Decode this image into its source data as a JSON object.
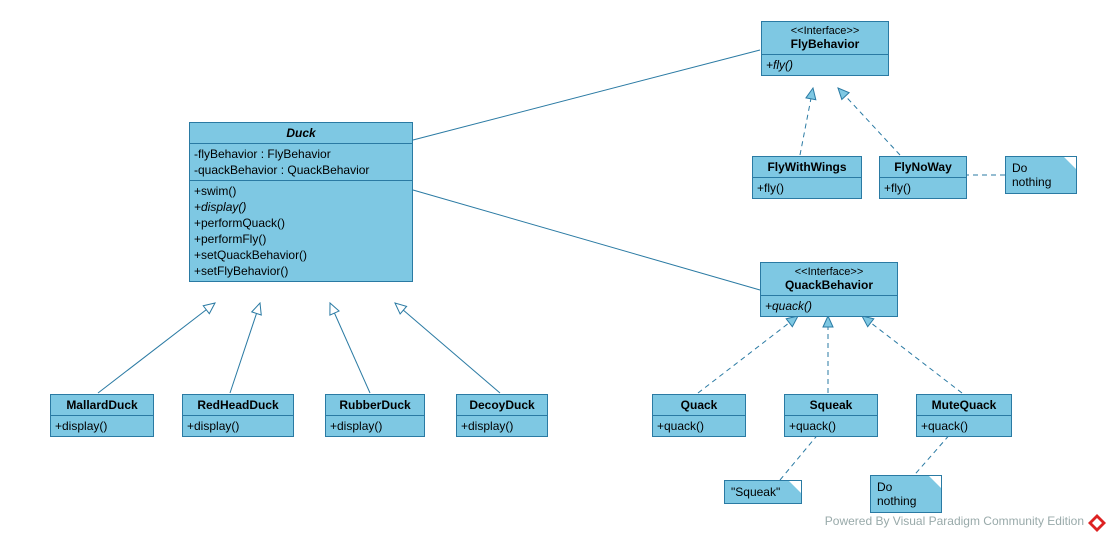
{
  "duck": {
    "name": "Duck",
    "attrs": [
      "-flyBehavior : FlyBehavior",
      "-quackBehavior : QuackBehavior"
    ],
    "ops": [
      "+swim()",
      "+display()",
      "+performQuack()",
      "+performFly()",
      "+setQuackBehavior()",
      "+setFlyBehavior()"
    ],
    "ops_italic": [
      false,
      true,
      false,
      false,
      false,
      false
    ]
  },
  "mallard": {
    "name": "MallardDuck",
    "ops": [
      "+display()"
    ]
  },
  "redhead": {
    "name": "RedHeadDuck",
    "ops": [
      "+display()"
    ]
  },
  "rubber": {
    "name": "RubberDuck",
    "ops": [
      "+display()"
    ]
  },
  "decoy": {
    "name": "DecoyDuck",
    "ops": [
      "+display()"
    ]
  },
  "flyBehavior": {
    "stereo": "<<Interface>>",
    "name": "FlyBehavior",
    "ops": [
      "+fly()"
    ],
    "ops_italic": [
      true
    ]
  },
  "flyWithWings": {
    "name": "FlyWithWings",
    "ops": [
      "+fly()"
    ]
  },
  "flyNoWay": {
    "name": "FlyNoWay",
    "ops": [
      "+fly()"
    ]
  },
  "quackBehavior": {
    "stereo": "<<Interface>>",
    "name": "QuackBehavior",
    "ops": [
      "+quack()"
    ],
    "ops_italic": [
      true
    ]
  },
  "quack": {
    "name": "Quack",
    "ops": [
      "+quack()"
    ]
  },
  "squeak": {
    "name": "Squeak",
    "ops": [
      "+quack()"
    ]
  },
  "muteQuack": {
    "name": "MuteQuack",
    "ops": [
      "+quack()"
    ]
  },
  "note_doNothingFly": "Do\nnothing",
  "note_squeak": "\"Squeak\"",
  "note_doNothingQuack": "Do\nnothing",
  "watermark": "Powered By Visual Paradigm Community Edition"
}
